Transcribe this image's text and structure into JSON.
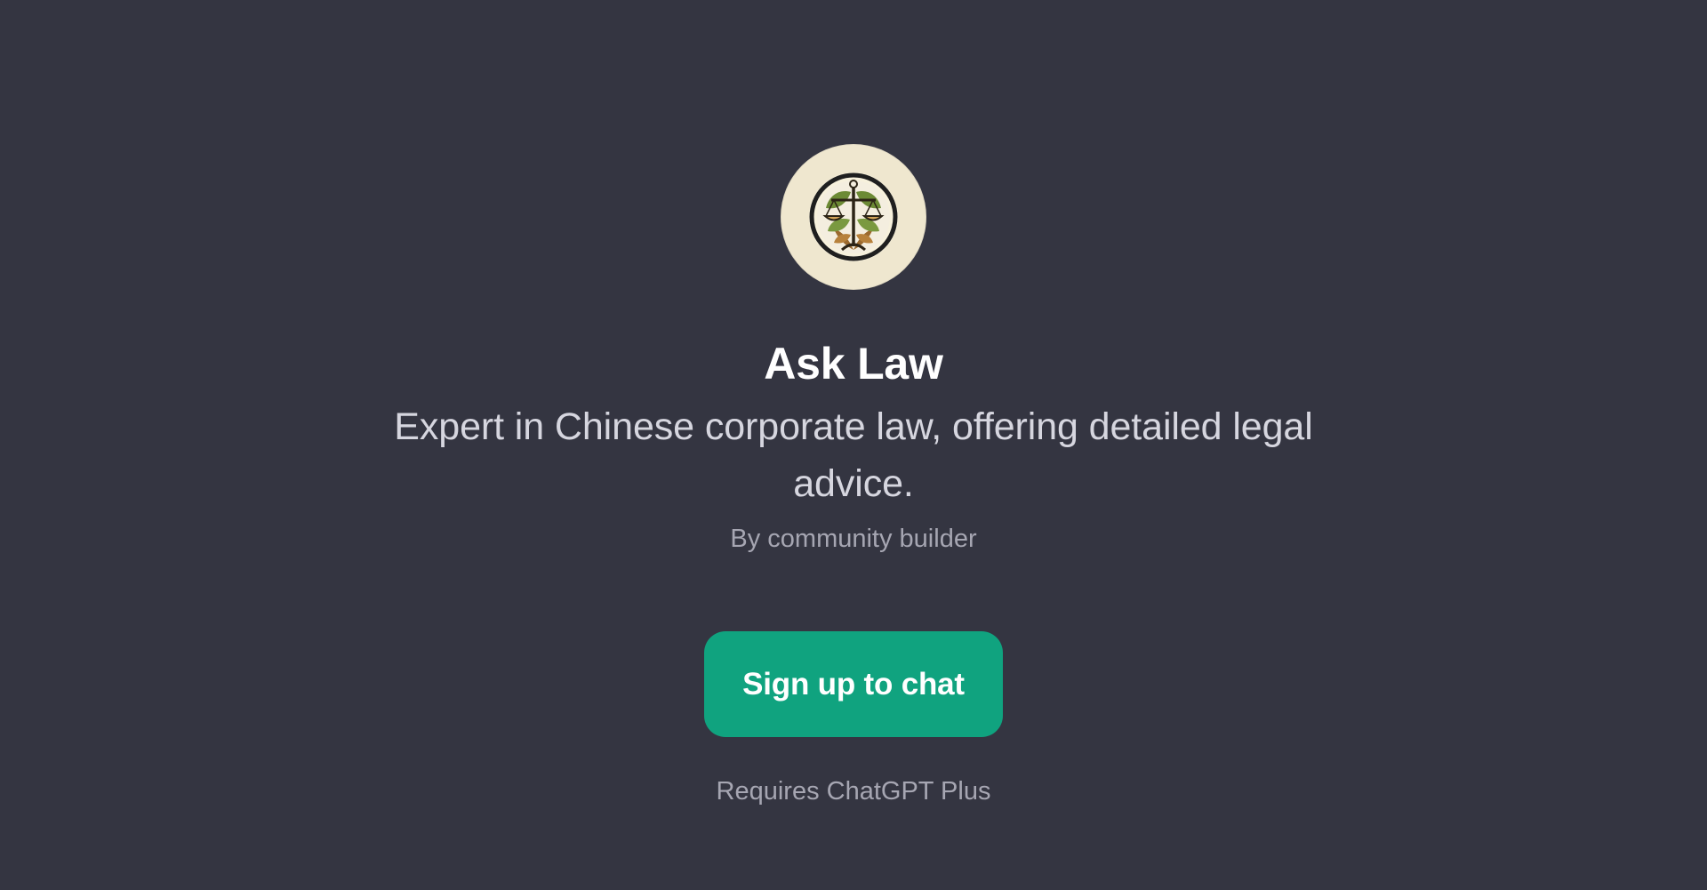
{
  "gpt": {
    "name": "Ask Law",
    "description": "Expert in Chinese corporate law, offering detailed legal advice.",
    "byline": "By community builder",
    "avatar_icon": "scales-of-justice-icon"
  },
  "actions": {
    "signup_label": "Sign up to chat"
  },
  "footer": {
    "requirement": "Requires ChatGPT Plus"
  },
  "colors": {
    "background": "#343541",
    "accent": "#10a37f",
    "avatar_bg": "#efe7cf"
  }
}
